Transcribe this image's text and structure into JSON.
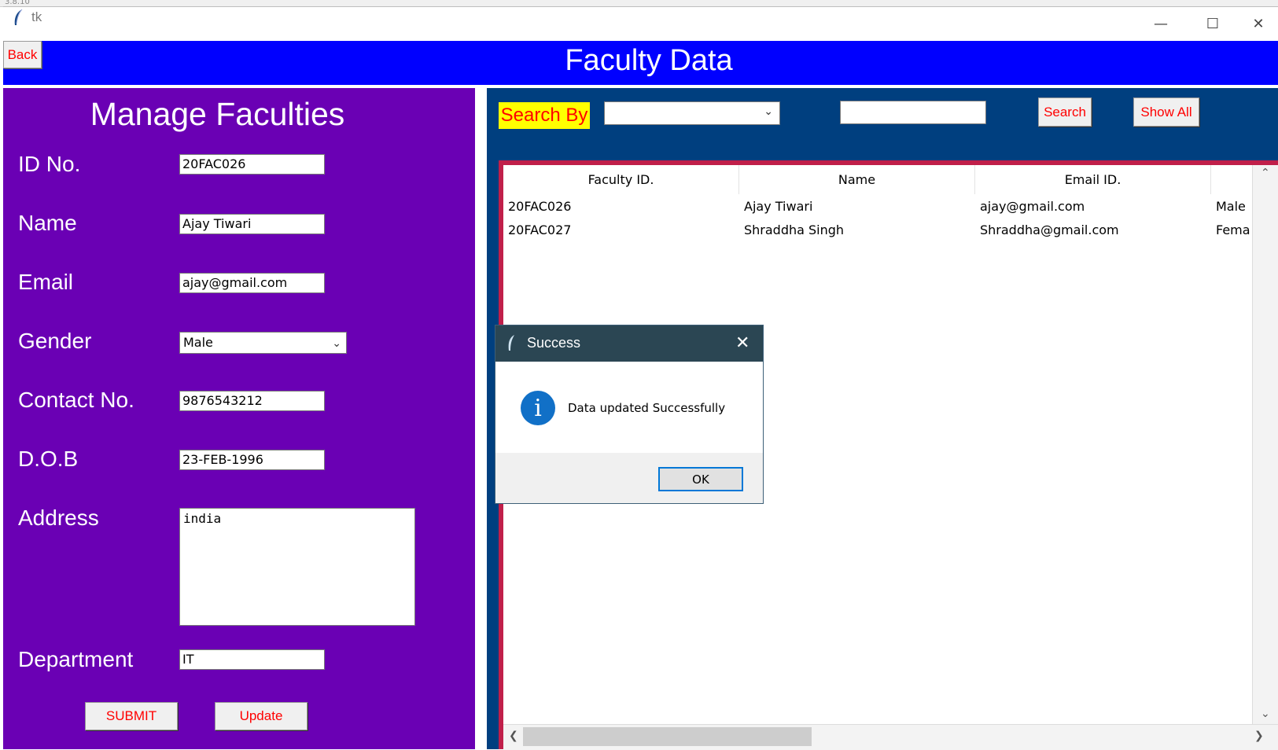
{
  "window": {
    "background_version": "3.8.10",
    "title": "tk",
    "minimize_icon": "minimize-icon",
    "maximize_icon": "maximize-icon",
    "close_icon": "close-icon"
  },
  "header": {
    "back_label": "Back",
    "title": "Faculty Data",
    "color": "#0000ff"
  },
  "form": {
    "title": "Manage Faculties",
    "panel_color": "#6a00b4",
    "fields": {
      "id": {
        "label": "ID No.",
        "value": "20FAC026"
      },
      "name": {
        "label": "Name",
        "value": "Ajay Tiwari"
      },
      "email": {
        "label": "Email",
        "value": "ajay@gmail.com"
      },
      "gender": {
        "label": "Gender",
        "value": "Male"
      },
      "contact": {
        "label": "Contact No.",
        "value": "9876543212"
      },
      "dob": {
        "label": "D.O.B",
        "value": "23-FEB-1996"
      },
      "address": {
        "label": "Address",
        "value": "india"
      },
      "department": {
        "label": "Department",
        "value": "IT"
      }
    },
    "submit_label": "SUBMIT",
    "update_label": "Update"
  },
  "search": {
    "label": "Search By",
    "selected": "",
    "query": "",
    "search_label": "Search",
    "show_all_label": "Show All",
    "panel_color": "#003f7f"
  },
  "table": {
    "columns": [
      "Faculty ID.",
      "Name",
      "Email ID."
    ],
    "rows": [
      [
        "20FAC026",
        "Ajay Tiwari",
        "ajay@gmail.com",
        "Male"
      ],
      [
        "20FAC027",
        "Shraddha Singh",
        "Shraddha@gmail.com",
        "Fema"
      ]
    ],
    "border_color": "#c01f4a"
  },
  "dialog": {
    "title": "Success",
    "message": "Data updated Successfully",
    "ok_label": "OK",
    "icon": "info-icon"
  }
}
